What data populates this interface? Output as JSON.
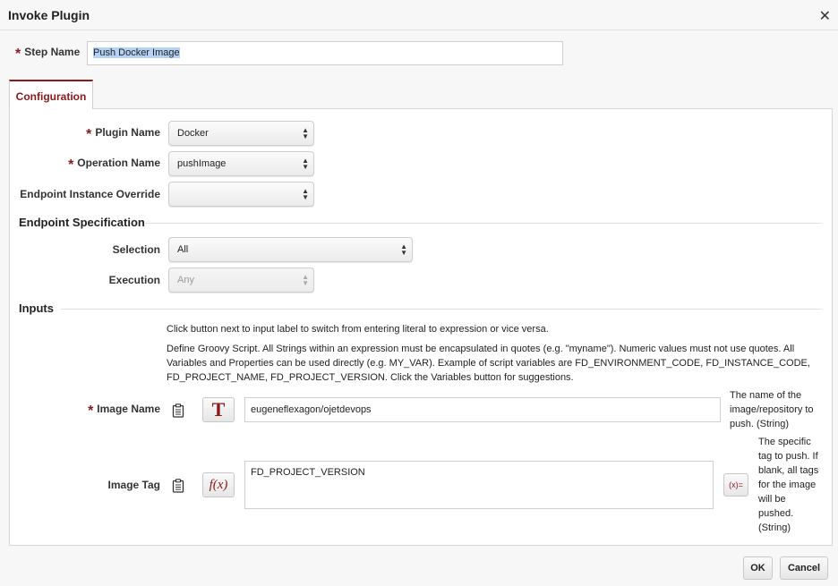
{
  "dialog": {
    "title": "Invoke Plugin",
    "close_glyph": "✕"
  },
  "step": {
    "label": "Step Name",
    "value": "Push Docker Image"
  },
  "tabs": [
    {
      "label": "Configuration",
      "active": true
    }
  ],
  "config": {
    "plugin_name": {
      "label": "Plugin Name",
      "value": "Docker",
      "required": true
    },
    "operation_name": {
      "label": "Operation Name",
      "value": "pushImage",
      "required": true
    },
    "endpoint_override": {
      "label": "Endpoint Instance Override",
      "value": ""
    }
  },
  "endpoint_spec": {
    "heading": "Endpoint Specification",
    "selection": {
      "label": "Selection",
      "value": "All"
    },
    "execution": {
      "label": "Execution",
      "value": "Any",
      "disabled": true
    }
  },
  "inputs": {
    "heading": "Inputs",
    "help1": "Click button next to input label to switch from entering literal to expression or vice versa.",
    "help2": "Define Groovy Script. All Strings within an expression must be encapsulated in quotes (e.g. \"myname\"). Numeric values must not use quotes. All Variables and Properties can be used directly (e.g. MY_VAR). Example of script variables are FD_ENVIRONMENT_CODE, FD_INSTANCE_CODE, FD_PROJECT_NAME, FD_PROJECT_VERSION. Click the Variables button for suggestions.",
    "image_name": {
      "label": "Image Name",
      "required": true,
      "mode_glyph": "T",
      "value": "eugeneflexagon/ojetdevops",
      "description": "The name of the image/repository to push. (String)"
    },
    "image_tag": {
      "label": "Image Tag",
      "mode_glyph": "f(x)",
      "value": "FD_PROJECT_VERSION",
      "var_glyph": "(x)=",
      "description": "The specific tag to push. If blank, all tags for the image will be pushed. (String)"
    }
  },
  "footer": {
    "ok_label": "OK",
    "cancel_label": "Cancel"
  },
  "icons": {
    "close": "close-icon",
    "clipboard": "clipboard-icon",
    "select_arrows": "updown-arrows-icon"
  },
  "colors": {
    "accent": "#8b1a1a",
    "selection": "#b4d2f5"
  }
}
